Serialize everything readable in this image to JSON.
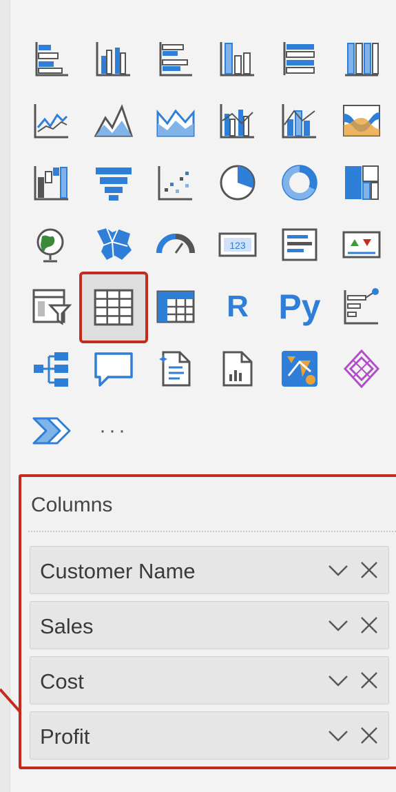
{
  "visualizations": {
    "rows": [
      [
        "stacked-bar-icon",
        "clustered-column-icon",
        "clustered-bar-icon",
        "stacked-column-icon",
        "100-stacked-bar-icon",
        "100-stacked-column-icon"
      ],
      [
        "line-chart-icon",
        "area-chart-icon",
        "stacked-area-icon",
        "line-clustered-column-icon",
        "line-stacked-column-icon",
        "ribbon-chart-icon"
      ],
      [
        "waterfall-chart-icon",
        "funnel-chart-icon",
        "scatter-chart-icon",
        "pie-chart-icon",
        "donut-chart-icon",
        "treemap-icon"
      ],
      [
        "map-icon",
        "filled-map-icon",
        "gauge-icon",
        "card-icon",
        "multi-row-card-icon",
        "kpi-icon"
      ],
      [
        "slicer-icon",
        "table-icon",
        "matrix-icon",
        "r-visual-icon",
        "python-visual-icon",
        "key-influencers-icon"
      ],
      [
        "decomposition-tree-icon",
        "qa-icon",
        "smart-narrative-icon",
        "paginated-report-icon",
        "azure-map-icon",
        "power-apps-icon"
      ],
      [
        "power-automate-icon",
        "more-visuals-icon"
      ]
    ],
    "selected": "table-icon",
    "r_label": "R",
    "py_label": "Py",
    "more_label": "···"
  },
  "fields_well": {
    "title": "Columns",
    "items": [
      {
        "label": "Customer Name"
      },
      {
        "label": "Sales"
      },
      {
        "label": "Cost"
      },
      {
        "label": "Profit"
      }
    ]
  },
  "colors": {
    "accent_blue": "#2f7ed8",
    "light_blue": "#7fb3ea",
    "highlight_red": "#c42b1c",
    "icon_gray": "#555555"
  }
}
